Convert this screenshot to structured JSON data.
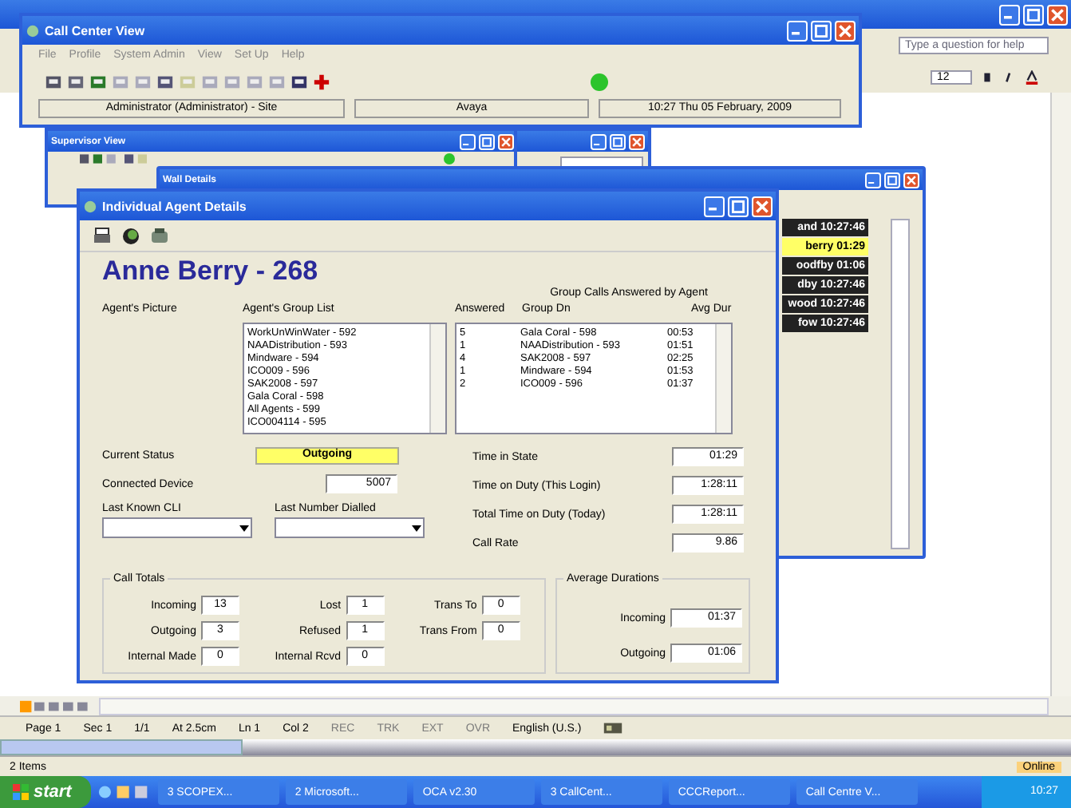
{
  "word_window": {
    "help_placeholder": "Type a question for help",
    "font_size": "12",
    "status_bar": [
      "Page 1",
      "Sec 1",
      "1/1",
      "At 2.5cm",
      "Ln 1",
      "Col 2"
    ],
    "indicators": [
      {
        "label": "REC",
        "disabled": true
      },
      {
        "label": "TRK",
        "disabled": true
      },
      {
        "label": "EXT",
        "disabled": true
      },
      {
        "label": "OVR",
        "disabled": true
      }
    ],
    "language": "English (U.S.)"
  },
  "call_center_window": {
    "title": "Call Center View",
    "menu": [
      "File",
      "Profile",
      "System Admin",
      "View",
      "Set Up",
      "Help"
    ],
    "connected": true,
    "status": [
      "Administrator (Administrator) - Site",
      "Avaya",
      "10:27 Thu 05 February, 2009"
    ]
  },
  "supervisor_window": {
    "title": "Supervisor View"
  },
  "wallboard_window": {
    "title": "Wall Details",
    "agents": [
      {
        "text": "and 10:27:46",
        "highlighted": false
      },
      {
        "text": "berry 01:29",
        "highlighted": true
      },
      {
        "text": "oodfby 01:06",
        "highlighted": false
      },
      {
        "text": "dby 10:27:46",
        "highlighted": false
      },
      {
        "text": "wood 10:27:46",
        "highlighted": false
      },
      {
        "text": "fow 10:27:46",
        "highlighted": false
      }
    ]
  },
  "agent_window": {
    "title": "Individual Agent Details",
    "name": "Anne Berry - 268",
    "picture_label": "Agent's Picture",
    "group_list_label": "Agent's Group List",
    "group_calls_title": "Group Calls Answered by Agent",
    "columns": [
      "Answered",
      "Group Dn",
      "Avg Dur"
    ],
    "group_list": [
      "WorkUnWinWater - 592",
      "NAADistribution - 593",
      "Mindware - 594",
      "ICO009 - 596",
      "SAK2008 - 597",
      "Gala Coral - 598",
      "All Agents - 599",
      "ICO004114 - 595"
    ],
    "answered": [
      {
        "answered": "5",
        "group": "Gala Coral - 598",
        "avg": "00:53"
      },
      {
        "answered": "1",
        "group": "NAADistribution - 593",
        "avg": "01:51"
      },
      {
        "answered": "4",
        "group": "SAK2008 - 597",
        "avg": "02:25"
      },
      {
        "answered": "1",
        "group": "Mindware - 594",
        "avg": "01:53"
      },
      {
        "answered": "2",
        "group": "ICO009 - 596",
        "avg": "01:37"
      }
    ],
    "current_status": {
      "label": "Current Status",
      "value": "Outgoing",
      "color": "#ffff66"
    },
    "connected_device": {
      "label": "Connected Device",
      "value": "5007"
    },
    "last_cli": {
      "label": "Last Known CLI"
    },
    "last_dialled": {
      "label": "Last Number Dialled"
    },
    "times": [
      {
        "label": "Time in State",
        "value": "01:29"
      },
      {
        "label": "Time on Duty (This Login)",
        "value": "1:28:11"
      },
      {
        "label": "Total Time on Duty (Today)",
        "value": "1:28:11"
      },
      {
        "label": "Call Rate",
        "value": "9.86"
      }
    ],
    "call_totals": {
      "title": "Call Totals",
      "columns": [
        [
          {
            "label": "Incoming",
            "value": "13"
          },
          {
            "label": "Outgoing",
            "value": "3"
          },
          {
            "label": "Internal Made",
            "value": "0"
          }
        ],
        [
          {
            "label": "Lost",
            "value": "1"
          },
          {
            "label": "Refused",
            "value": "1"
          },
          {
            "label": "Internal Rcvd",
            "value": "0"
          }
        ],
        [
          {
            "label": "Trans To",
            "value": "0"
          },
          {
            "label": "Trans From",
            "value": "0"
          }
        ]
      ]
    },
    "average_durations": {
      "title": "Average Durations",
      "rows": [
        {
          "label": "Incoming",
          "value": "01:37"
        },
        {
          "label": "Outgoing",
          "value": "01:06"
        }
      ]
    }
  },
  "outlook_status": {
    "items": "2 Items",
    "online": "Online"
  },
  "taskbar": {
    "start": "start",
    "tasks": [
      "3 SCOPEX...",
      "2 Microsoft...",
      "OCA v2.30",
      "3 CallCent...",
      "CCCReport...",
      "Call Centre V..."
    ],
    "clock": "10:27"
  }
}
